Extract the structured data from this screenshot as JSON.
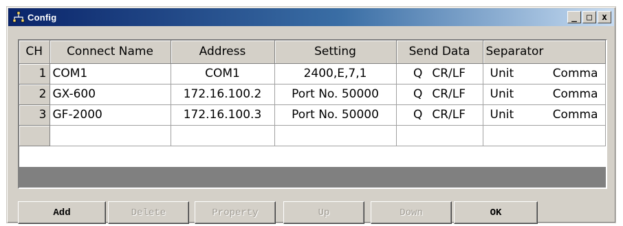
{
  "window": {
    "title": "Config",
    "buttons": {
      "minimize": "_",
      "maximize": "□",
      "close": "x"
    }
  },
  "grid": {
    "columns": [
      "CH",
      "Connect Name",
      "Address",
      "Setting",
      "Send Data",
      "Separator"
    ],
    "rows": [
      {
        "ch": "1",
        "name": "COM1",
        "address": "COM1",
        "setting": "2400,E,7,1",
        "send_q": "Q",
        "send_term": "CR/LF",
        "sep_unit": "Unit",
        "sep_type": "Comma"
      },
      {
        "ch": "2",
        "name": "GX-600",
        "address": "172.16.100.2",
        "setting": "Port No. 50000",
        "send_q": "Q",
        "send_term": "CR/LF",
        "sep_unit": "Unit",
        "sep_type": "Comma"
      },
      {
        "ch": "3",
        "name": "GF-2000",
        "address": "172.16.100.3",
        "setting": "Port No. 50000",
        "send_q": "Q",
        "send_term": "CR/LF",
        "sep_unit": "Unit",
        "sep_type": "Comma"
      }
    ]
  },
  "buttons": {
    "add": "Add",
    "delete": "Delete",
    "property": "Property",
    "up": "Up",
    "down": "Down",
    "ok": "OK"
  },
  "colors": {
    "titlebar_start": "#0a246a",
    "titlebar_end": "#c7dcf2",
    "face": "#d4d0c8"
  }
}
